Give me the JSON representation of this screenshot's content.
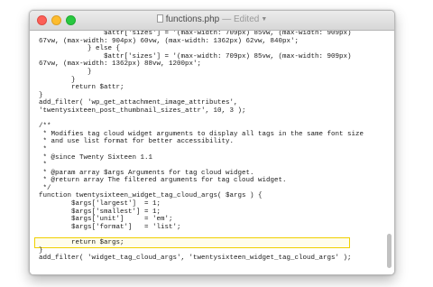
{
  "window": {
    "filename": "functions.php",
    "status": "— Edited"
  },
  "editor": {
    "lines": [
      "                $attr['sizes'] = '(max-width: 709px) 85vw, (max-width: 909px)",
      "67vw, (max-width: 904px) 60vw, (max-width: 1362px) 62vw, 840px';",
      "            } else {",
      "                $attr['sizes'] = '(max-width: 709px) 85vw, (max-width: 909px)",
      "67vw, (max-width: 1362px) 88vw, 1200px';",
      "            }",
      "        }",
      "        return $attr;",
      "}",
      "add_filter( 'wp_get_attachment_image_attributes',",
      "'twentysixteen_post_thumbnail_sizes_attr', 10, 3 );",
      "",
      "/**",
      " * Modifies tag cloud widget arguments to display all tags in the same font size",
      " * and use list format for better accessibility.",
      " *",
      " * @since Twenty Sixteen 1.1",
      " *",
      " * @param array $args Arguments for tag cloud widget.",
      " * @return array The filtered arguments for tag cloud widget.",
      " */",
      "function twentysixteen_widget_tag_cloud_args( $args ) {",
      "        $args['largest']  = 1;",
      "        $args['smallest'] = 1;",
      "        $args['unit']     = 'em';",
      "        $args['format']   = 'list';",
      "",
      "        return $args;",
      "}",
      "add_filter( 'widget_tag_cloud_args', 'twentysixteen_widget_tag_cloud_args' );"
    ]
  }
}
